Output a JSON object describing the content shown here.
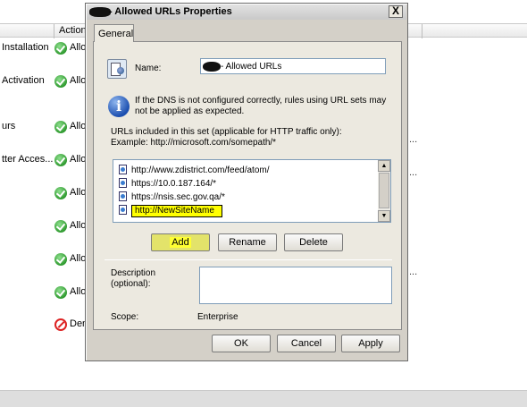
{
  "background": {
    "column_action": "Action",
    "rows": [
      {
        "name": "Installation",
        "action": "Allo",
        "icon": "allow-icon",
        "ellipsis": ""
      },
      {
        "name": "Activation",
        "action": "Allo",
        "icon": "allow-icon",
        "ellipsis": ""
      },
      {
        "name": "urs",
        "action": "Allo",
        "icon": "allow-icon",
        "ellipsis": "..."
      },
      {
        "name": "tter Acces...",
        "action": "Allo",
        "icon": "allow-icon",
        "ellipsis": "..."
      },
      {
        "name": "",
        "action": "Allo",
        "icon": "allow-icon",
        "ellipsis": ""
      },
      {
        "name": "",
        "action": "Allo",
        "icon": "allow-icon",
        "ellipsis": ""
      },
      {
        "name": "",
        "action": "Allo",
        "icon": "allow-icon",
        "ellipsis": "..."
      },
      {
        "name": "",
        "action": "Allo",
        "icon": "allow-icon",
        "ellipsis": ""
      },
      {
        "name": "",
        "action": "Den",
        "icon": "deny-icon",
        "ellipsis": ""
      }
    ]
  },
  "dialog": {
    "title": "- Allowed URLs Properties",
    "close_label": "X",
    "tab": "General",
    "name_label": "Name:",
    "name_value": "- Allowed URLs",
    "info_text_1": "If the DNS is not configured correctly, rules using URL sets may",
    "info_text_2": "not be applied as expected.",
    "urls_label_1": "URLs included in this set (applicable for HTTP traffic only):",
    "urls_label_2": "Example: http://microsoft.com/somepath/*",
    "urls": [
      "http://www.zdistrict.com/feed/atom/",
      "https://10.0.187.164/*",
      "https://nsis.sec.gov.qa/*"
    ],
    "editing_url": "http://NewSiteName",
    "buttons": {
      "add": "Add",
      "rename": "Rename",
      "delete": "Delete"
    },
    "description_label_1": "Description",
    "description_label_2": "(optional):",
    "scope_label": "Scope:",
    "scope_value": "Enterprise",
    "footer": {
      "ok": "OK",
      "cancel": "Cancel",
      "apply": "Apply"
    }
  }
}
